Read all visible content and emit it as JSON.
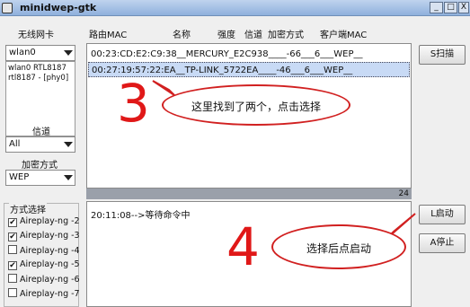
{
  "window": {
    "title": "minidwep-gtk",
    "minimize": "_",
    "maximize": "□",
    "close": "X"
  },
  "left": {
    "wireless_label": "无线网卡",
    "iface_select": "wlan0",
    "iface_info": "wlan0 RTL8187\nrtl8187 - [phy0]",
    "channel_label": "信道",
    "channel_select": "All",
    "encryption_label": "加密方式",
    "encryption_select": "WEP",
    "method_label": "方式选择",
    "methods": [
      {
        "label": "Aireplay-ng -2",
        "checked": true
      },
      {
        "label": "Aireplay-ng -3",
        "checked": true
      },
      {
        "label": "Aireplay-ng -4",
        "checked": false
      },
      {
        "label": "Aireplay-ng -5",
        "checked": true
      },
      {
        "label": "Aireplay-ng -6",
        "checked": false
      },
      {
        "label": "Aireplay-ng -7",
        "checked": false
      }
    ]
  },
  "columns": {
    "router_mac": "路由MAC",
    "name": "名称",
    "strength": "强度",
    "channel": "信道",
    "encryption": "加密方式",
    "client_mac": "客户端MAC"
  },
  "ap_rows": [
    {
      "text": "00:23:CD:E2:C9:38__MERCURY_E2C938____-66___6___WEP__",
      "selected": false
    },
    {
      "text": "00:27:19:57:22:EA__TP-LINK_5722EA____-46___6___WEP__",
      "selected": true
    }
  ],
  "ap_count": "24",
  "log": {
    "line": "20:11:08-->等待命令中"
  },
  "buttons": {
    "scan": "S扫描",
    "start": "L启动",
    "stop": "A停止"
  },
  "annotations": {
    "step3_number": "3",
    "step3_text": "这里找到了两个，点击选择",
    "step4_number": "4",
    "step4_text": "选择后点启动",
    "accent_color": "#e01818"
  }
}
